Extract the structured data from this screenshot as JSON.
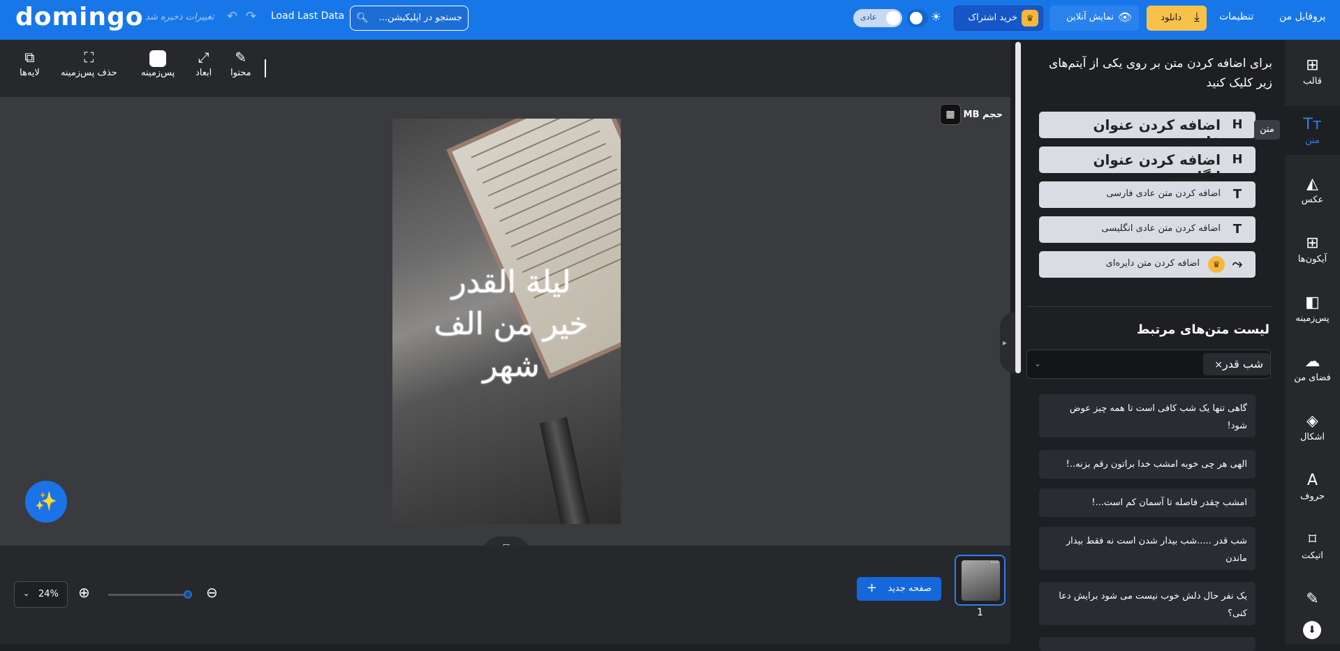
{
  "header": {
    "logo": "domingo",
    "saved_status": "تغییرات ذخیره شد",
    "load_last": "Load Last Data",
    "search_placeholder": "جستجو در اپلیکیشن...",
    "mode_label": "عادی",
    "subscribe_label": "خرید اشتراک",
    "online_label": "نمایش آنلاین",
    "download_label": "دانلود",
    "settings_label": "تنظیمات",
    "profile_label": "پروفایل من"
  },
  "toolbar": {
    "layers": "لایه‌ها",
    "remove_bg": "حذف پس‌زمینه",
    "background": "پس‌زمینه",
    "dimensions": "ابعاد",
    "content": "محتوا"
  },
  "canvas": {
    "size_label": "حجم MB",
    "calligraphy": "لیلة القدر خیر من الف شهر"
  },
  "bottom": {
    "zoom": "24%",
    "new_page": "صفحه جدید",
    "page_number": "1"
  },
  "panel": {
    "title": "برای اضافه کردن متن بر روی یکی از آیتم‌های زیر کلیک کنید",
    "buttons": [
      {
        "label": "اضافه کردن عنوان فارسی",
        "icon": "H"
      },
      {
        "label": "اضافه کردن عنوان انگلیسی",
        "icon": "H"
      },
      {
        "label": "اضافه کردن متن عادی فارسی",
        "icon": "T"
      },
      {
        "label": "اضافه کردن متن عادی انگلیسی",
        "icon": "T"
      },
      {
        "label": "اضافه کردن متن دایره‌ای",
        "icon": "curve-text-icon"
      }
    ],
    "related_title": "لیست متن‌های مرتبط",
    "tag": "شب قدر",
    "related": [
      "گاهی تنها یک شب کافی است تا همه چیز عوض شود!",
      "الهی هر چی خوبه امشب خدا براتون رقم بزنه..!",
      "امشب چقدر فاصله تا آسمان کم است...!",
      "شب قدر .....شب بیدار شدن است نه فقط بیدار ماندن",
      "یک نفر حال دلش خوب نیست می شود برایش دعا کنی؟"
    ]
  },
  "sidebar": {
    "tooltip": "متن",
    "items": [
      {
        "label": "قالب",
        "icon": "layout-icon"
      },
      {
        "label": "متن",
        "icon": "text-icon"
      },
      {
        "label": "عکس",
        "icon": "image-icon"
      },
      {
        "label": "آیکون‌ها",
        "icon": "grid-icon"
      },
      {
        "label": "پس‌زمینه",
        "icon": "background-icon"
      },
      {
        "label": "فضای من",
        "icon": "upload-icon"
      },
      {
        "label": "اشکال",
        "icon": "shapes-icon"
      },
      {
        "label": "حروف",
        "icon": "letters-icon"
      },
      {
        "label": "اتیکت",
        "icon": "tag-icon"
      },
      {
        "label": "",
        "icon": "pen-icon"
      }
    ]
  },
  "colors": {
    "brand": "#1877e8",
    "accent_yellow": "#f7c24a",
    "panel_bg": "#1e1f22"
  }
}
